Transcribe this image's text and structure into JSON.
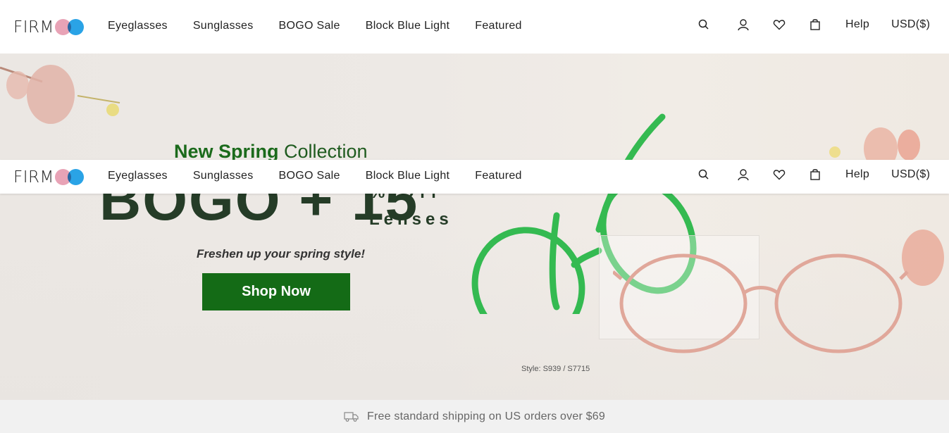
{
  "brand": {
    "logo_text": "FIRM",
    "circle_colors": [
      "#e8a3b6",
      "#2aa3e6"
    ]
  },
  "nav": {
    "links": [
      "Eyeglasses",
      "Sunglasses",
      "BOGO Sale",
      "Block Blue Light",
      "Featured"
    ],
    "icons": [
      "search-icon",
      "user-icon",
      "heart-icon",
      "bag-icon"
    ],
    "help": "Help",
    "currency": "USD($)"
  },
  "hero": {
    "subtitle_bold": "New Spring",
    "subtitle_rest": " Collection",
    "headline": "BOGO + 15",
    "off_text": "% Off",
    "lenses_text": "Lenses",
    "tagline": "Freshen up your spring style!",
    "cta": "Shop Now",
    "style_caption": "Style: S939 / S7715",
    "accent_color": "#146b16"
  },
  "banner": {
    "text": "Free standard shipping on US orders over $69",
    "icon": "truck-icon"
  }
}
